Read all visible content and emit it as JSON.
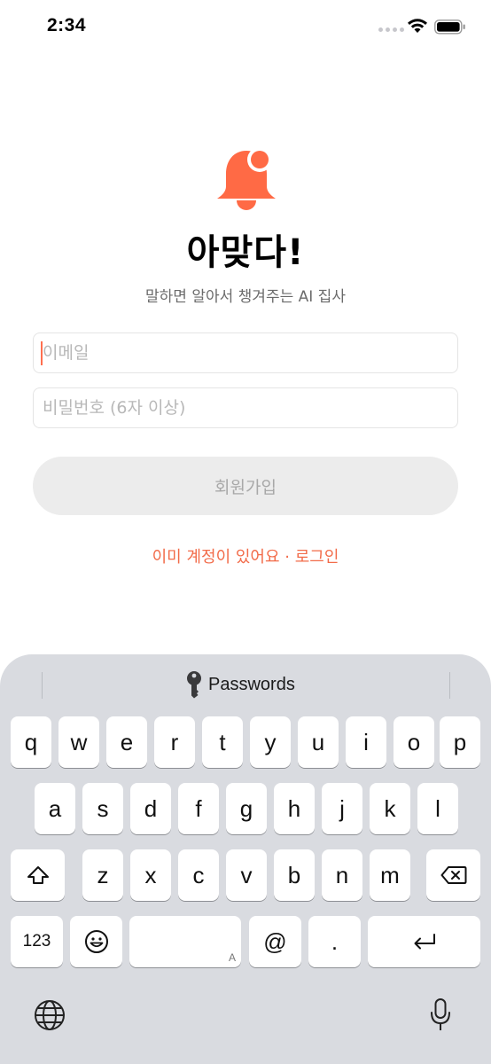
{
  "status_bar": {
    "time": "2:34"
  },
  "app": {
    "title": "아맞다!",
    "subtitle": "말하면 알아서 챙겨주는 AI 집사",
    "accent_color": "#f26b49"
  },
  "form": {
    "email": {
      "value": "",
      "placeholder": "이메일"
    },
    "password": {
      "value": "",
      "placeholder": "비밀번호 (6자 이상)"
    },
    "signup_label": "회원가입",
    "login_link": "이미 계정이 있어요 · 로그인"
  },
  "keyboard": {
    "suggestion": "Passwords",
    "row1": [
      "q",
      "w",
      "e",
      "r",
      "t",
      "y",
      "u",
      "i",
      "o",
      "p"
    ],
    "row2": [
      "a",
      "s",
      "d",
      "f",
      "g",
      "h",
      "j",
      "k",
      "l"
    ],
    "row3": [
      "z",
      "x",
      "c",
      "v",
      "b",
      "n",
      "m"
    ],
    "numbers_label": "123",
    "at_label": "@",
    "dot_label": ".",
    "space_hint": "A"
  }
}
